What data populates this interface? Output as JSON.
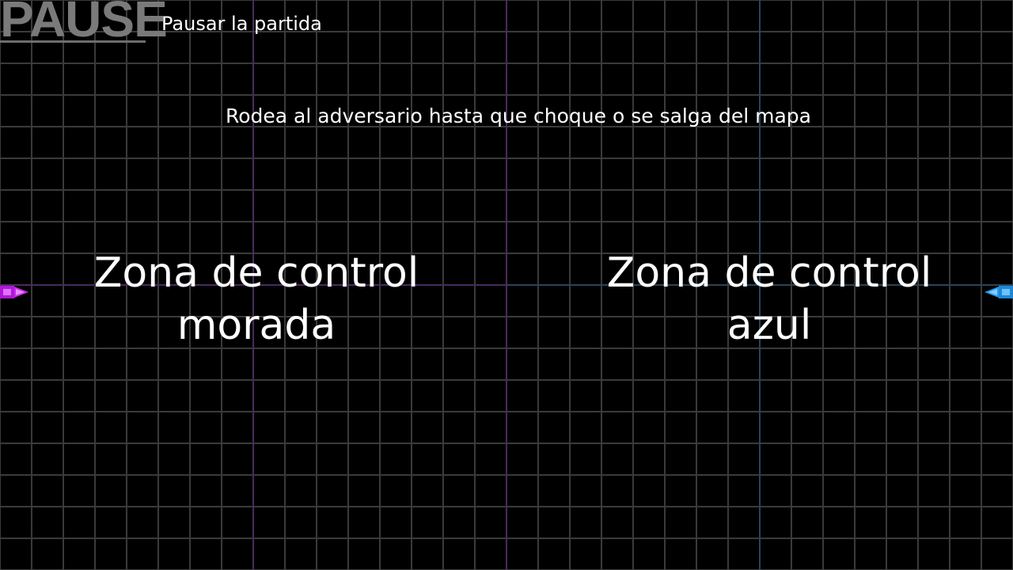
{
  "pause": {
    "logo_text": "PAUSE",
    "label": "Pausar la partida"
  },
  "instruction": "Rodea al adversario hasta que choque o se salga del mapa",
  "zones": {
    "purple": {
      "label": "Zona de control morada",
      "color": "#c020e0"
    },
    "blue": {
      "label": "Zona de control azul",
      "color": "#30a8f0"
    }
  },
  "colors": {
    "background": "#000000",
    "grid": "#3a3a3a",
    "text": "#ffffff"
  },
  "players": {
    "purple": {
      "icon": "purple-player-ship-icon"
    },
    "blue": {
      "icon": "blue-player-ship-icon"
    }
  }
}
